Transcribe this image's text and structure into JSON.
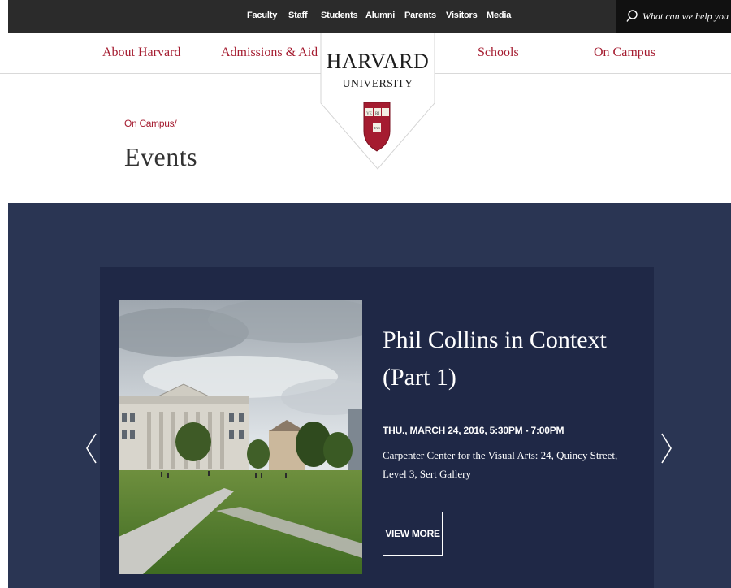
{
  "utility_nav": {
    "links": [
      "Faculty",
      "Staff",
      "Students",
      "Alumni",
      "Parents",
      "Visitors",
      "Media"
    ]
  },
  "search": {
    "placeholder": "What can we help you find?",
    "icon": "search-icon"
  },
  "main_nav": {
    "left": [
      "About Harvard",
      "Admissions & Aid"
    ],
    "right": [
      "Schools",
      "On Campus"
    ]
  },
  "logo": {
    "title": "HARVARD",
    "subtitle": "UNIVERSITY",
    "crest_letters": [
      "VE",
      "RI",
      "TAS"
    ]
  },
  "breadcrumb": "On Campus/",
  "page_title": "Events",
  "featured_event": {
    "title": "Phil Collins in Context (Part 1)",
    "datetime": "THU., MARCH 24, 2016, 5:30PM - 7:00PM",
    "location": "Carpenter Center for the Visual Arts: 24, Quincy Street, Level 3, Sert Gallery",
    "button_label": "VIEW MORE"
  },
  "carousel": {
    "prev_icon": "chevron-left-icon",
    "next_icon": "chevron-right-icon"
  },
  "colors": {
    "crimson": "#a51c30",
    "topbar": "#2b2b2b",
    "hero_bg": "#2a3553",
    "card_bg": "#1f2846"
  }
}
